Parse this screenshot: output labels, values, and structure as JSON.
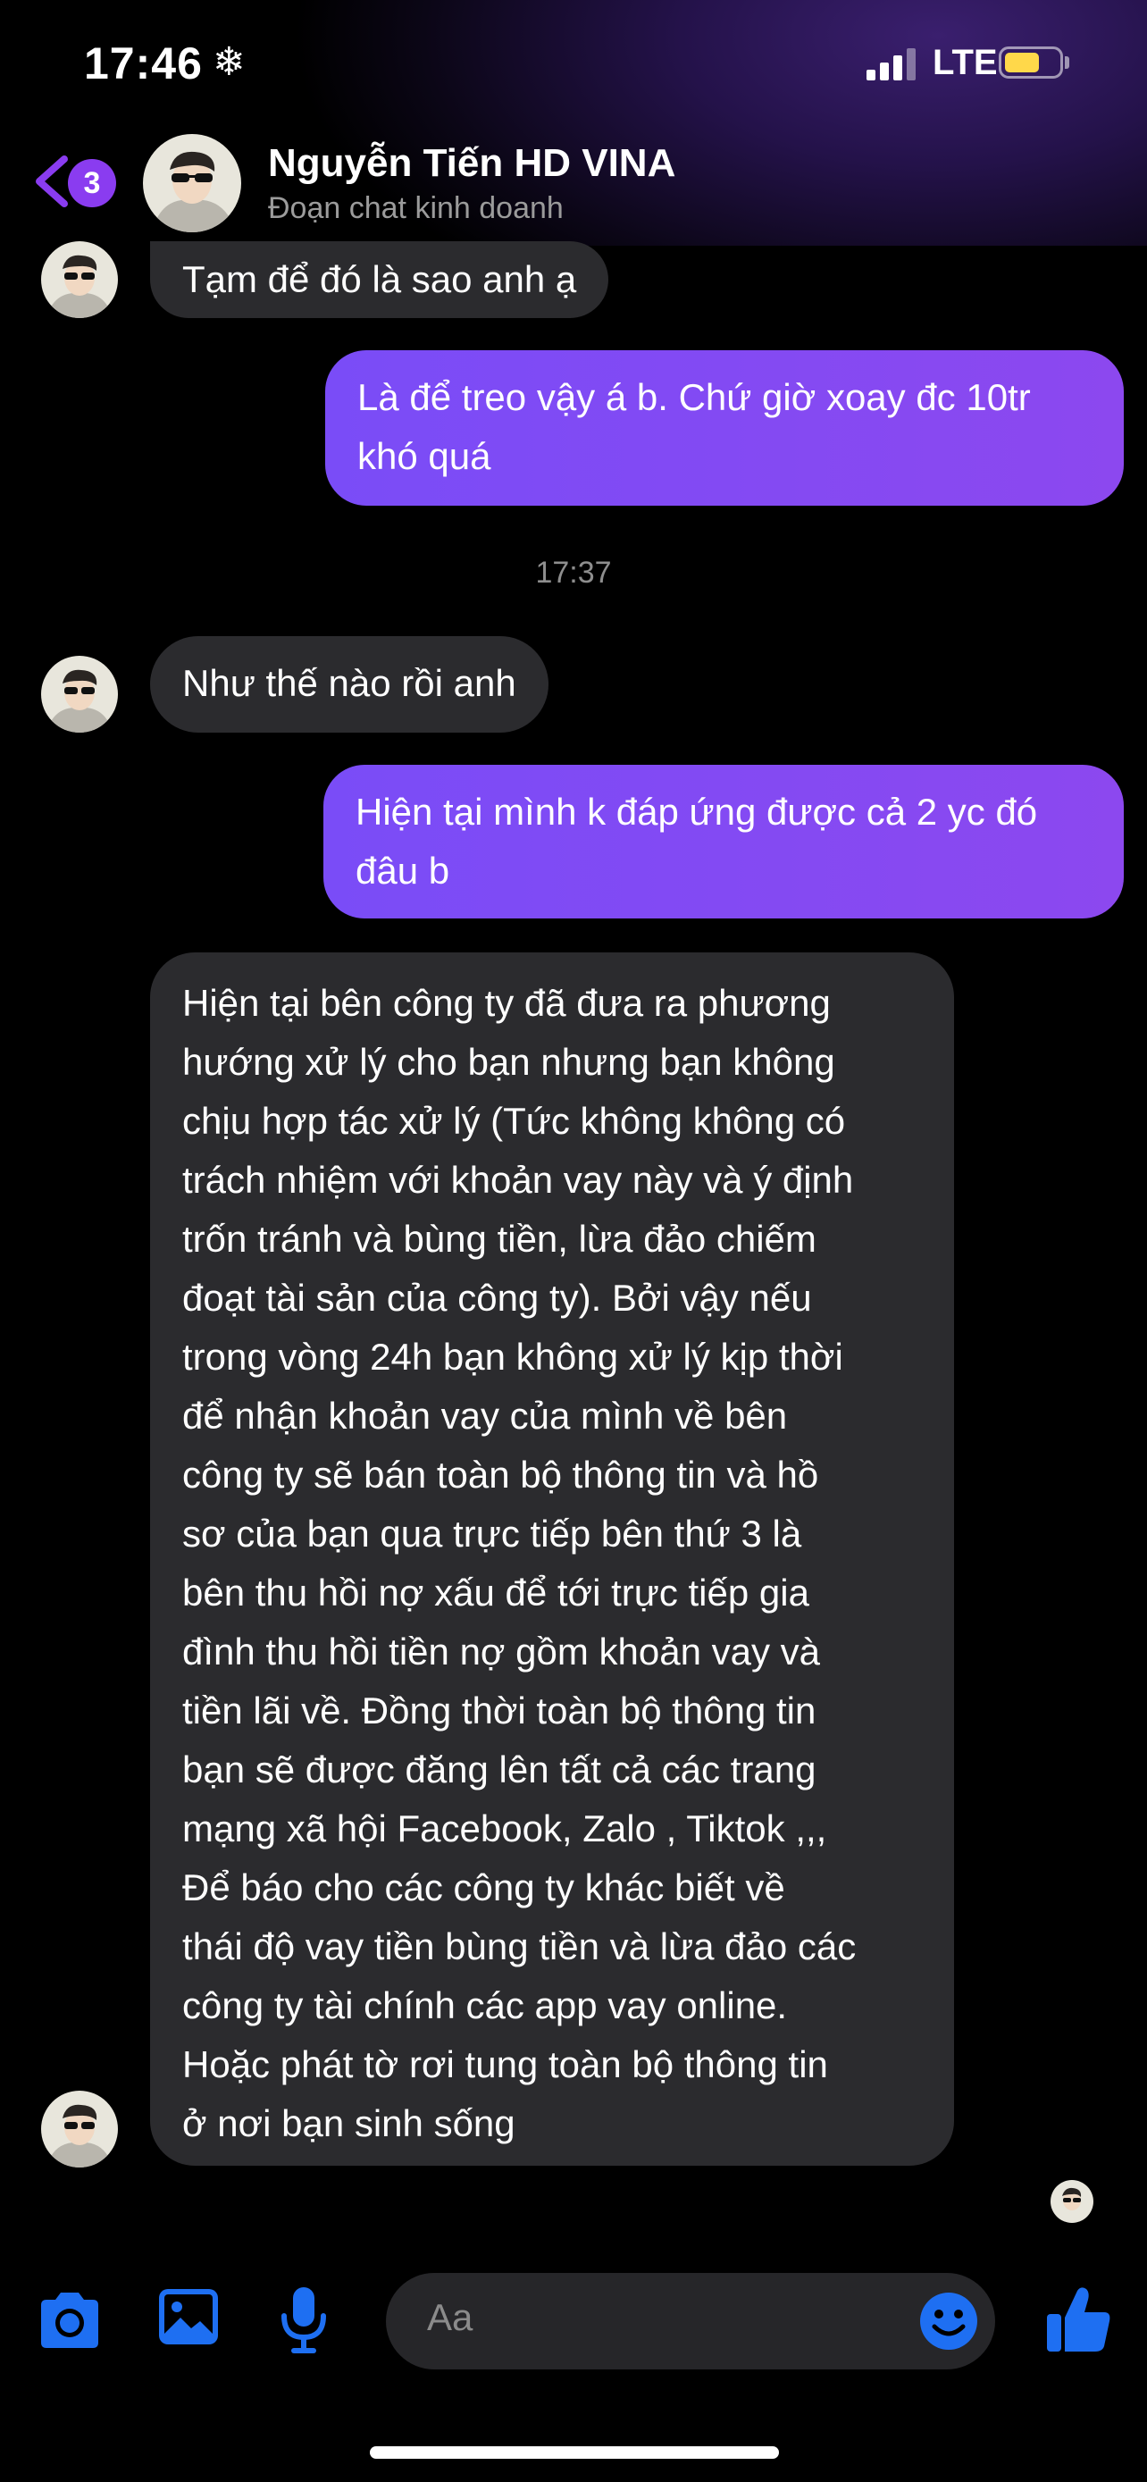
{
  "status": {
    "time": "17:46",
    "network": "LTE"
  },
  "header": {
    "back_count": "3",
    "name": "Nguyễn Tiến HD VINA",
    "subtitle": "Đoạn chat kinh doanh"
  },
  "messages": {
    "m1": "Tạm để đó là sao anh ạ",
    "m2_l1": "Là để treo vậy á b. Chứ giờ xoay đc 10tr",
    "m2_l2": "khó quá",
    "timestamp": "17:37",
    "m3": "Như thế nào rồi anh",
    "m4_l1": "Hiện tại mình k đáp ứng được cả 2 yc đó",
    "m4_l2": "đâu b",
    "m5_lines": [
      "Hiện tại bên công ty đã đưa ra phương",
      "hướng xử lý cho bạn nhưng bạn không",
      "chịu hợp tác xử lý (Tức không không có",
      "trách nhiệm với khoản vay này và ý định",
      "trốn tránh và bùng tiền, lừa đảo chiếm",
      "đoạt tài sản của công ty). Bởi vậy nếu",
      "trong vòng 24h bạn không xử lý kịp thời",
      "để nhận khoản vay của mình về bên",
      "công ty sẽ bán toàn bộ thông tin và hồ",
      "sơ của bạn qua trực tiếp bên thứ 3 là",
      "bên thu hồi nợ xấu để tới trực tiếp gia",
      "đình thu hồi tiền nợ gồm khoản vay và",
      "tiền lãi về. Đồng thời toàn bộ thông tin",
      "bạn sẽ được đăng lên tất cả các trang",
      "mạng xã hội Facebook, Zalo , Tiktok ,,,",
      "Để báo cho các công ty khác biết về",
      "thái độ vay tiền bùng tiền và lừa đảo các",
      "công ty tài chính các app vay online.",
      "Hoặc phát tờ rơi tung toàn bộ thông tin",
      "ở  nơi bạn  sinh sống"
    ]
  },
  "composer": {
    "placeholder": "Aa"
  },
  "colors": {
    "accent": "#8a3cf0",
    "icon_blue": "#1e6ff2",
    "outgoing": "#7a4cf7",
    "incoming": "#2b2b2e"
  },
  "icons": [
    "snowflake-icon",
    "signal-icon",
    "battery-icon",
    "back-chevron-icon",
    "camera-icon",
    "image-icon",
    "microphone-icon",
    "emoji-icon",
    "thumbs-up-icon"
  ]
}
